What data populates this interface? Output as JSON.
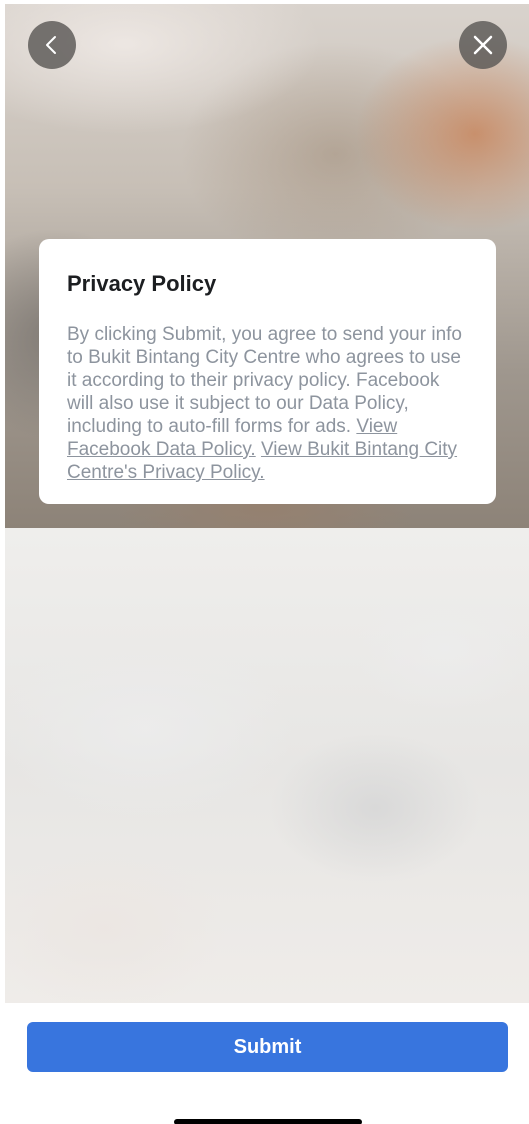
{
  "icons": {
    "back": "chevron-left-icon",
    "close": "close-icon"
  },
  "privacy_card": {
    "title": "Privacy Policy",
    "body": "By clicking Submit, you agree to send your info to Bukit Bintang City Centre who agrees to use it according to their privacy policy. Facebook will also use it subject to our Data Policy, including to auto-fill forms for ads.",
    "link_facebook_policy": "View Facebook Data Policy.",
    "link_business_policy": "View Bukit Bintang City Centre's Privacy Policy."
  },
  "footer": {
    "submit_label": "Submit"
  },
  "colors": {
    "primary_button": "#3875de",
    "card_text": "#8d949e",
    "title_text": "#1c1e21"
  }
}
